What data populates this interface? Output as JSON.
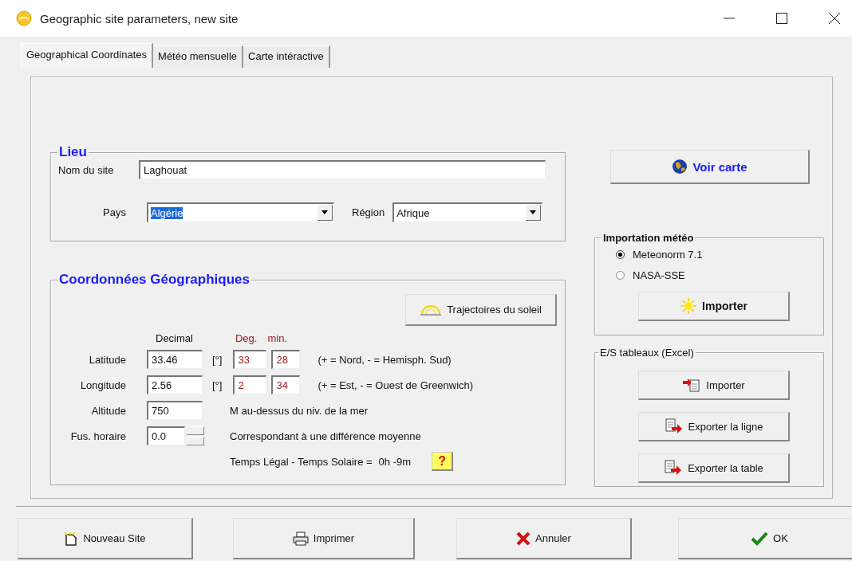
{
  "window": {
    "title": "Geographic site parameters, new site"
  },
  "tabs": [
    {
      "label": "Geographical Coordinates",
      "selected": true
    },
    {
      "label": "Météo mensuelle",
      "selected": false
    },
    {
      "label": "Carte intéractive",
      "selected": false
    }
  ],
  "lieu": {
    "title": "Lieu",
    "site_name": {
      "label": "Nom du site",
      "value": "Laghouat"
    },
    "country": {
      "label": "Pays",
      "value": "Algérie",
      "highlighted": true
    },
    "region": {
      "label": "Région",
      "value": "Afrique",
      "highlighted": false
    }
  },
  "coords": {
    "title": "Coordonnées Géographiques",
    "sun_button": "Trajectoires du soleil",
    "headers": {
      "decimal": "Decimal",
      "deg": "Deg.",
      "min": "min."
    },
    "rows": [
      {
        "label": "Latitude",
        "decimal": "33.46",
        "unit": "[°]",
        "deg": "33",
        "min": "28",
        "note": "(+ = Nord,  - = Hemisph. Sud)"
      },
      {
        "label": "Longitude",
        "decimal": "2.56",
        "unit": "[°]",
        "deg": "2",
        "min": "34",
        "note": "(+ = Est, - = Ouest de Greenwich)"
      }
    ],
    "altitude": {
      "label": "Altitude",
      "value": "750",
      "note": "M au-dessus du niv. de la mer"
    },
    "timezone": {
      "label": "Fus. horaire",
      "value": "0.0",
      "note": "Correspondant à une différence moyenne"
    },
    "time_difference": {
      "label": "Temps Légal - Temps Solaire =",
      "value": "0h -9m",
      "help": "?"
    }
  },
  "map_button": "Voir carte",
  "meteo_import": {
    "title": "Importation météo",
    "options": [
      {
        "label": "Meteonorm 7.1",
        "selected": true
      },
      {
        "label": "NASA-SSE",
        "selected": false
      }
    ],
    "button": "Importer"
  },
  "excel": {
    "title": "E/S tableaux (Excel)",
    "buttons": [
      {
        "label": "Importer",
        "kind": "import"
      },
      {
        "label": "Exporter la ligne",
        "kind": "export"
      },
      {
        "label": "Exporter la table",
        "kind": "export"
      }
    ]
  },
  "footer_buttons": [
    {
      "label": "Nouveau Site",
      "kind": "new"
    },
    {
      "label": "Imprimer",
      "kind": "print"
    },
    {
      "label": "Annuler",
      "kind": "cancel"
    },
    {
      "label": "OK",
      "kind": "ok"
    }
  ]
}
